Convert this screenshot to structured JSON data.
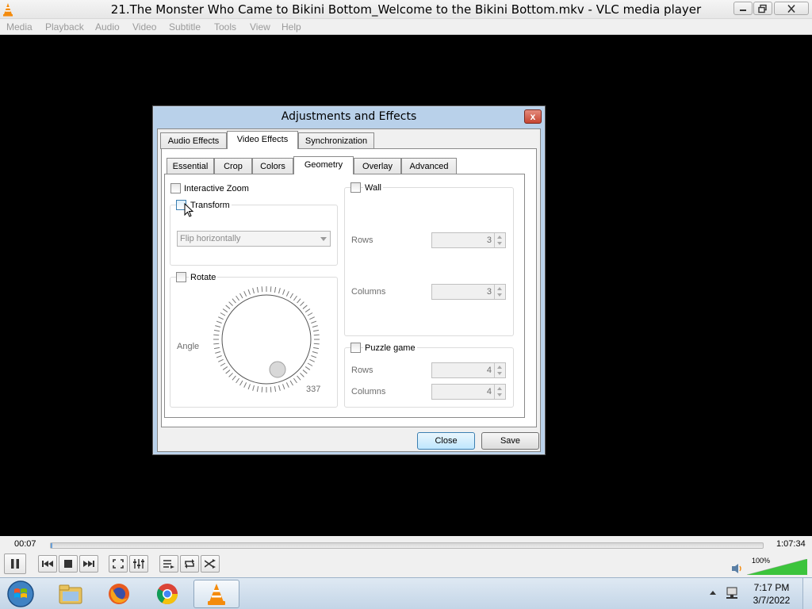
{
  "window": {
    "title": "21.The Monster Who Came to Bikini Bottom_Welcome to the Bikini Bottom.mkv - VLC media player",
    "buttons": {
      "minimize": "minimize-icon",
      "maximize": "restore-icon",
      "close": "close-icon"
    }
  },
  "menu": {
    "items": [
      "Media",
      "Playback",
      "Audio",
      "Video",
      "Subtitle",
      "Tools",
      "View",
      "Help"
    ]
  },
  "dialog": {
    "title": "Adjustments and Effects",
    "close_glyph": "x",
    "main_tabs": [
      "Audio Effects",
      "Video Effects",
      "Synchronization"
    ],
    "active_main_tab": "Video Effects",
    "sub_tabs": [
      "Essential",
      "Crop",
      "Colors",
      "Geometry",
      "Overlay",
      "Advanced"
    ],
    "active_sub_tab": "Geometry",
    "interactive_zoom": {
      "label": "Interactive Zoom",
      "checked": false
    },
    "transform": {
      "label": "Transform",
      "checked": false,
      "select_value": "Flip horizontally"
    },
    "rotate": {
      "label": "Rotate",
      "checked": false,
      "angle_label": "Angle",
      "angle_value": "337"
    },
    "wall": {
      "label": "Wall",
      "checked": false,
      "rows_label": "Rows",
      "rows_value": "3",
      "columns_label": "Columns",
      "columns_value": "3"
    },
    "puzzle": {
      "label": "Puzzle game",
      "checked": false,
      "rows_label": "Rows",
      "rows_value": "4",
      "columns_label": "Columns",
      "columns_value": "4"
    },
    "close_button": "Close",
    "save_button": "Save"
  },
  "player": {
    "elapsed": "00:07",
    "total": "1:07:34",
    "progress": 0.002,
    "volume_label": "100%",
    "volume": 1.0,
    "buttons": [
      "pause-icon",
      "previous-icon",
      "stop-icon",
      "next-icon",
      "fullscreen-icon",
      "extended-settings-icon",
      "playlist-icon",
      "loop-icon",
      "shuffle-icon"
    ]
  },
  "taskbar": {
    "apps": [
      "windows-start-icon",
      "file-explorer-icon",
      "firefox-icon",
      "chrome-icon",
      "vlc-icon"
    ],
    "time": "7:17 PM",
    "date": "3/7/2022"
  },
  "colors": {
    "video_background": "#000000",
    "dialog_frame": "#b9d1ea",
    "vlc_orange": "#f48b0c",
    "volume_green": "#3cc43c"
  }
}
